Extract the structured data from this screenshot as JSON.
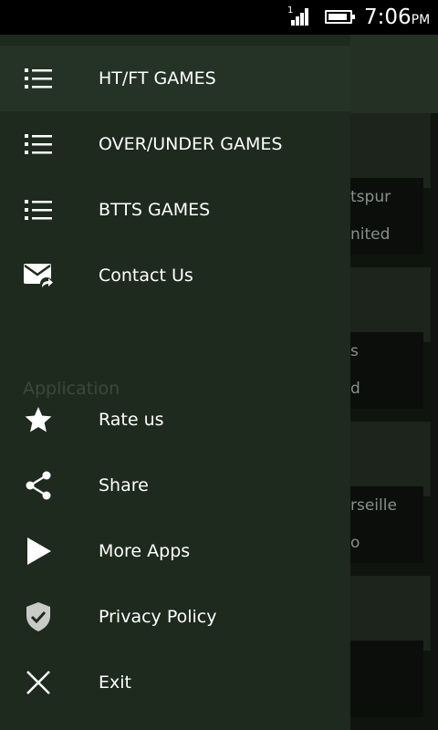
{
  "status_bar": {
    "signal_label": "1",
    "time": "7:06",
    "ampm": "PM"
  },
  "background": {
    "texts": [
      "tspur",
      "nited",
      "s",
      "d",
      "rseille",
      "o"
    ]
  },
  "drawer": {
    "games": [
      {
        "label": "HT/FT GAMES",
        "icon": "list-icon"
      },
      {
        "label": "OVER/UNDER GAMES",
        "icon": "list-icon"
      },
      {
        "label": "BTTS GAMES",
        "icon": "list-icon"
      },
      {
        "label": "Contact Us",
        "icon": "mail-forward-icon"
      }
    ],
    "section_header": "Application",
    "app_items": [
      {
        "label": "Rate us",
        "icon": "star-icon"
      },
      {
        "label": "Share",
        "icon": "share-icon"
      },
      {
        "label": "More Apps",
        "icon": "play-icon"
      },
      {
        "label": "Privacy Policy",
        "icon": "shield-check-icon"
      },
      {
        "label": "Exit",
        "icon": "close-icon"
      }
    ]
  }
}
